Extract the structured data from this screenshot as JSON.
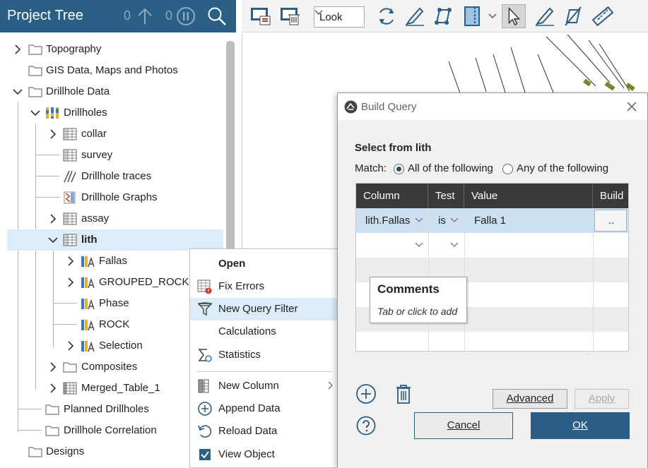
{
  "tree": {
    "title": "Project Tree",
    "header_count_up": "0",
    "header_count_pause": "0",
    "items": [
      {
        "label": "Topography"
      },
      {
        "label": "GIS Data, Maps and Photos"
      },
      {
        "label": "Drillhole Data"
      },
      {
        "label": "Drillholes"
      },
      {
        "label": "collar"
      },
      {
        "label": "survey"
      },
      {
        "label": "Drillhole traces"
      },
      {
        "label": "Drillhole Graphs"
      },
      {
        "label": "assay"
      },
      {
        "label": "lith"
      },
      {
        "label": "Fallas"
      },
      {
        "label": "GROUPED_ROCK"
      },
      {
        "label": "Phase"
      },
      {
        "label": "ROCK"
      },
      {
        "label": "Selection"
      },
      {
        "label": "Composites"
      },
      {
        "label": "Merged_Table_1"
      },
      {
        "label": "Planned Drillholes"
      },
      {
        "label": "Drillhole Correlation"
      },
      {
        "label": "Designs"
      }
    ]
  },
  "toolbar": {
    "look_value": "Look"
  },
  "context_menu": {
    "items": [
      {
        "label": "Open"
      },
      {
        "label": "Fix Errors"
      },
      {
        "label": "New Query Filter"
      },
      {
        "label": "Calculations"
      },
      {
        "label": "Statistics"
      },
      {
        "label": "New Column"
      },
      {
        "label": "Append Data"
      },
      {
        "label": "Reload Data"
      },
      {
        "label": "View Object"
      }
    ]
  },
  "dialog": {
    "title": "Build Query",
    "select_from": "Select from lith",
    "match_label": "Match:",
    "match_all": "All of the following",
    "match_any": "Any of the following",
    "columns": [
      "Column",
      "Test",
      "Value",
      "Build"
    ],
    "row": {
      "column": "lith.Fallas",
      "test": "is",
      "value": "Falla 1",
      "build": ".."
    },
    "tooltip_title": "Comments",
    "tooltip_hint": "Tab or click to add",
    "advanced_label": "Advanced",
    "apply_label": "Apply",
    "cancel_label": "Cancel",
    "ok_label": "OK"
  },
  "colors": {
    "header_blue": "#2b5f85",
    "selection": "#dcecf8",
    "grid_header": "#3a3a3a"
  }
}
